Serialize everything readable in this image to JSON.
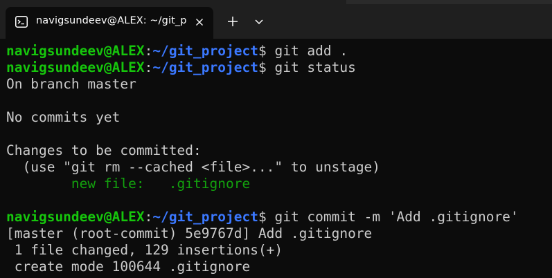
{
  "tab": {
    "title": "navigsundeev@ALEX: ~/git_p",
    "icon": "terminal-icon"
  },
  "titlebar_buttons": {
    "close_icon": "close-icon",
    "new_tab_icon": "plus-icon",
    "dropdown_icon": "chevron-down-icon"
  },
  "colors": {
    "background": "#0c0c0c",
    "titlebar": "#1f1f1f",
    "prompt_user": "#16c60c",
    "prompt_path": "#3b78ff",
    "text": "#cccccc",
    "staged_file": "#13a10e"
  },
  "prompt": {
    "user": "navigsundeev@ALEX",
    "colon": ":",
    "path": "~/git_project",
    "sign": "$"
  },
  "lines": [
    {
      "type": "prompt",
      "cmd": " git add ."
    },
    {
      "type": "prompt",
      "cmd": " git status"
    },
    {
      "type": "text",
      "text": "On branch master"
    },
    {
      "type": "text",
      "text": ""
    },
    {
      "type": "text",
      "text": "No commits yet"
    },
    {
      "type": "text",
      "text": ""
    },
    {
      "type": "text",
      "text": "Changes to be committed:"
    },
    {
      "type": "text",
      "text": "  (use \"git rm --cached <file>...\" to unstage)"
    },
    {
      "type": "staged",
      "indent": "        ",
      "text": "new file:   .gitignore"
    },
    {
      "type": "text",
      "text": ""
    },
    {
      "type": "prompt",
      "cmd": " git commit -m 'Add .gitignore'"
    },
    {
      "type": "text",
      "text": "[master (root-commit) 5e9767d] Add .gitignore"
    },
    {
      "type": "text",
      "text": " 1 file changed, 129 insertions(+)"
    },
    {
      "type": "text",
      "text": " create mode 100644 .gitignore"
    }
  ]
}
